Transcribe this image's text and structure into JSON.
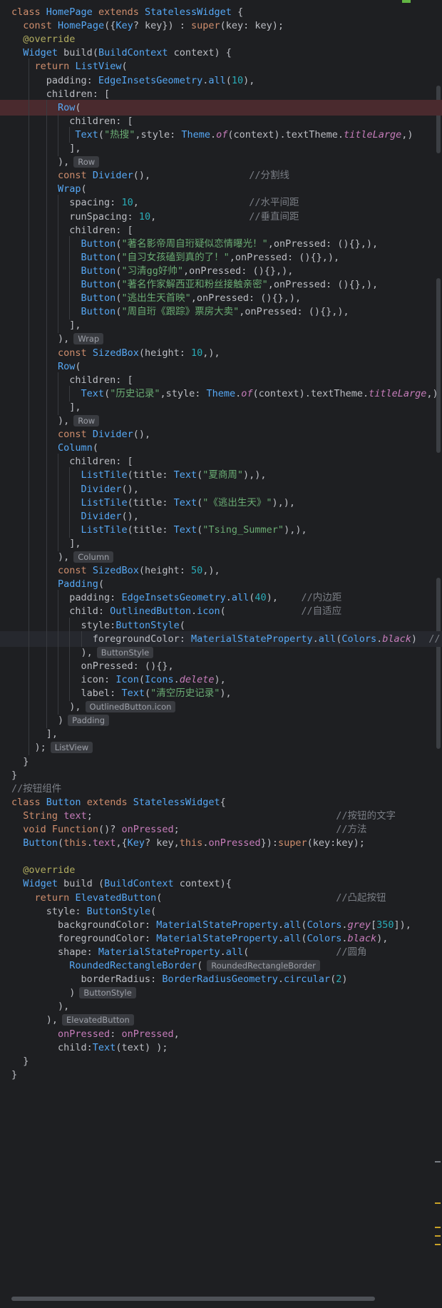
{
  "code_lines": [
    "class HomePage extends StatelessWidget {",
    "  const HomePage({Key? key}) : super(key: key);",
    "  @override",
    "  Widget build(BuildContext context) {",
    "    return ListView(",
    "      padding: EdgeInsetsGeometry.all(10),",
    "      children: [",
    "        Row(",
    "          children: [",
    "           Text(\"热搜\",style: Theme.of(context).textTheme.titleLarge,)",
    "          ],",
    "        ),",
    "        const Divider(),                 //分割线",
    "        Wrap(",
    "          spacing: 10,                   //水平间距",
    "          runSpacing: 10,                //垂直间距",
    "          children: [",
    "            Button(\"著名影帝周自珩疑似恋情曝光！\",onPressed: (){},),",
    "            Button(\"自习女孩磕到真的了！\",onPressed: (){},),",
    "            Button(\"习清gg好帅\",onPressed: (){},),",
    "            Button(\"著名作家解西亚和粉丝接触亲密\",onPressed: (){},),",
    "            Button(\"逃出生天首映\",onPressed: (){},),",
    "            Button(\"周自珩《跟踪》票房大卖\",onPressed: (){},),",
    "          ],",
    "        ),",
    "        const SizedBox(height: 10,),",
    "        Row(",
    "          children: [",
    "            Text(\"历史记录\",style: Theme.of(context).textTheme.titleLarge,)",
    "          ],",
    "        ),",
    "        const Divider(),",
    "        Column(",
    "          children: [",
    "            ListTile(title: Text(\"夏商周\"),),",
    "            Divider(),",
    "            ListTile(title: Text(\"《逃出生天》\"),),",
    "            Divider(),",
    "            ListTile(title: Text(\"Tsing_Summer\"),),",
    "          ],",
    "        ),",
    "        const SizedBox(height: 50,),",
    "        Padding(",
    "          padding: EdgeInsetsGeometry.all(40),    //内边距",
    "          child: OutlinedButton.icon(             //自适应",
    "            style:ButtonStyle(",
    "              foregroundColor: MaterialStateProperty.all(Colors.black)  //",
    "            ),",
    "            onPressed: (){},",
    "            icon: Icon(Icons.delete),",
    "            label: Text(\"清空历史记录\"),",
    "          ),",
    "        )",
    "      ],",
    "    );",
    "  }",
    "}",
    "//按钮组件",
    "class Button extends StatelessWidget{",
    "  String text;                                          //按钮的文字",
    "  void Function()? onPressed;                           //方法",
    "  Button(this.text,{Key? key,this.onPressed}):super(key:key);",
    "",
    "  @override",
    "  Widget build (BuildContext context){",
    "    return ElevatedButton(                              //凸起按钮",
    "      style: ButtonStyle(",
    "        backgroundColor: MaterialStateProperty.all(Colors.grey[350]),",
    "        foregroundColor: MaterialStateProperty.all(Colors.black),",
    "        shape: MaterialStateProperty.all(               //圆角",
    "          RoundedRectangleBorder(",
    "            borderRadius: BorderRadiusGeometry.circular(2)",
    "          )",
    "        ),",
    "      ),",
    "        onPressed: onPressed,",
    "        child:Text(text) );",
    "  }",
    "}"
  ],
  "hints": {
    "l11": "Row",
    "l24": "Wrap",
    "l30": "Row",
    "l40": "Column",
    "l47": "ButtonStyle",
    "l51": "OutlinedButton.icon",
    "l52": "Padding",
    "l54": "ListView",
    "l70": "RoundedRectangleBorder",
    "l72": "ButtonStyle",
    "l74": "ElevatedButton"
  },
  "colors": {
    "background": "#1e1f22",
    "keyword": "#cf8e6d",
    "class_name": "#56a8f5",
    "number": "#2aacb8",
    "string": "#6aab73",
    "comment": "#7a7e85",
    "property": "#c77dbb",
    "breakpoint_line": "#4a2a2e"
  }
}
